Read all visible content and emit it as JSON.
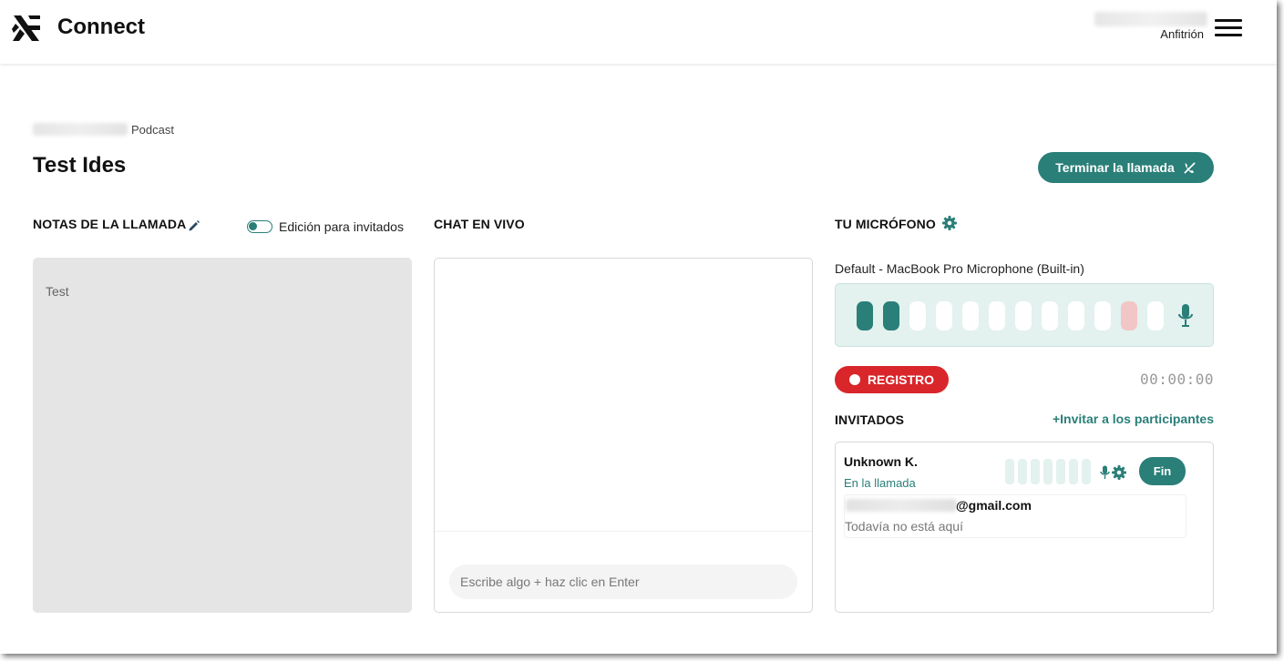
{
  "header": {
    "app_title": "Connect",
    "user_role": "Anfitrión",
    "logo_icon": "connect-logo",
    "menu_icon": "hamburger-menu-icon"
  },
  "page": {
    "breadcrumb": "Podcast",
    "title": "Test Ides",
    "end_call_label": "Terminar la llamada"
  },
  "notes": {
    "title": "NOTAS DE LA LLAMADA",
    "guest_edit_label": "Edición para invitados",
    "guest_edit_enabled": false,
    "content": "Test"
  },
  "chat": {
    "title": "CHAT EN VIVO",
    "input_placeholder": "Escribe algo + haz clic en Enter"
  },
  "microphone": {
    "title": "TU MICRÓFONO",
    "device": "Default - MacBook Pro Microphone (Built-in)",
    "level_bars": 12,
    "active_bars": 2,
    "peak_bar": 11,
    "record_label": "REGISTRO",
    "timer": "00:00:00"
  },
  "guests": {
    "title": "INVITADOS",
    "invite_label": "+Invitar a los participantes",
    "joined": {
      "name": "Unknown K.",
      "status": "En la llamada",
      "end_label": "Fin"
    },
    "pending": {
      "email_suffix": "@gmail.com",
      "status": "Todavía no está aquí"
    }
  },
  "colors": {
    "accent": "#2a7f78",
    "record": "#d9262b",
    "meter_bg": "#e3f1ef",
    "notes_bg": "#e5e5e5"
  }
}
